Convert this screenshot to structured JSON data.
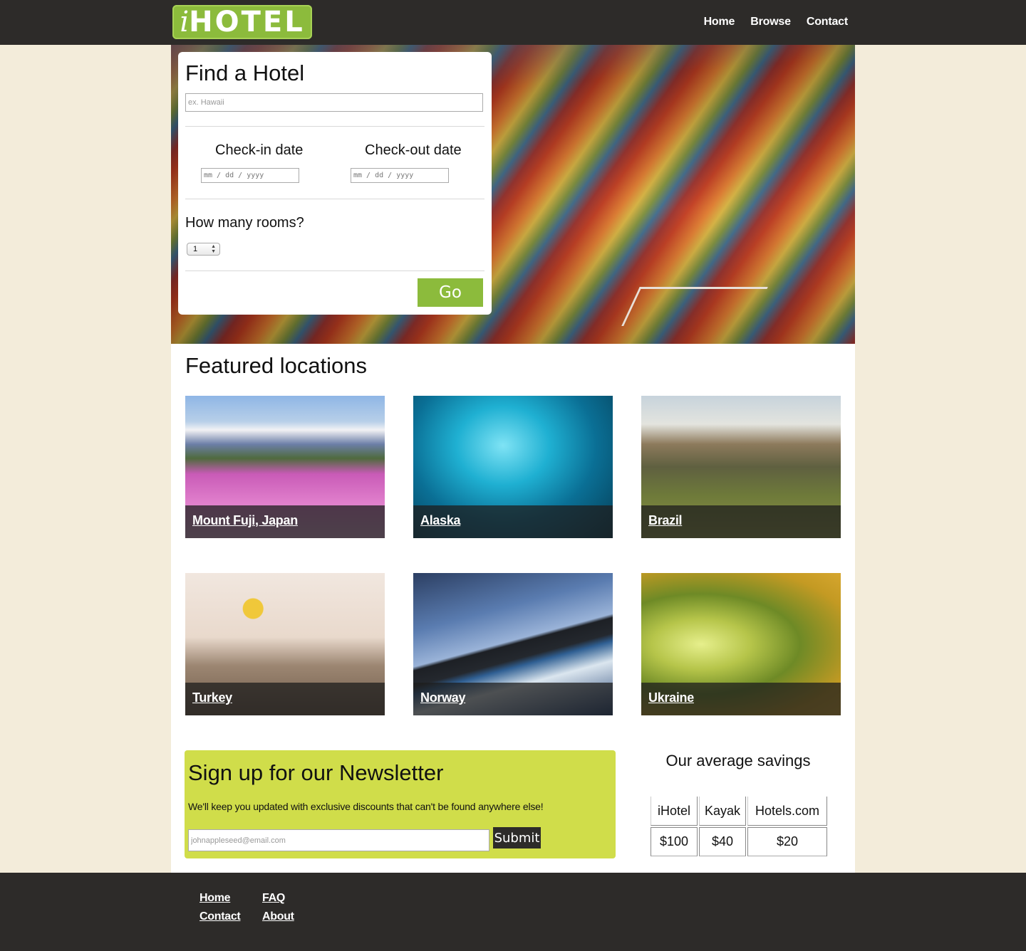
{
  "header": {
    "logo_letter": "i",
    "logo_word": "HOTEL",
    "nav": [
      "Home",
      "Browse",
      "Contact"
    ]
  },
  "search": {
    "title": "Find a Hotel",
    "destination_placeholder": "ex. Hawaii",
    "checkin_label": "Check-in date",
    "checkout_label": "Check-out date",
    "date_placeholder": "mm / dd / yyyy",
    "rooms_label": "How many rooms?",
    "rooms_value": "1",
    "go_label": "Go"
  },
  "featured": {
    "title": "Featured locations",
    "locations": [
      {
        "label": "Mount Fuji, Japan",
        "icon": "mount-fuji-photo"
      },
      {
        "label": "Alaska",
        "icon": "ice-cave-photo"
      },
      {
        "label": "Brazil",
        "icon": "mesa-photo"
      },
      {
        "label": "Turkey",
        "icon": "balloons-photo"
      },
      {
        "label": "Norway",
        "icon": "cliff-photo"
      },
      {
        "label": "Ukraine",
        "icon": "tunnel-of-love-photo"
      }
    ]
  },
  "newsletter": {
    "title": "Sign up for our Newsletter",
    "text": "We'll keep you updated with exclusive discounts that can't be found anywhere else!",
    "email_placeholder": "johnappleseed@email.com",
    "submit_label": "Submit"
  },
  "savings": {
    "title": "Our average savings",
    "headers": [
      "iHotel",
      "Kayak",
      "Hotels.com"
    ],
    "values": [
      "$100",
      "$40",
      "$20"
    ]
  },
  "footer": {
    "links": [
      "Home",
      "FAQ",
      "Contact",
      "About"
    ]
  },
  "colors": {
    "brand_green": "#8cbb3c",
    "newsletter_bg": "#d0dd4a",
    "dark_bar": "#2d2b29",
    "page_bg": "#f3ecda"
  }
}
